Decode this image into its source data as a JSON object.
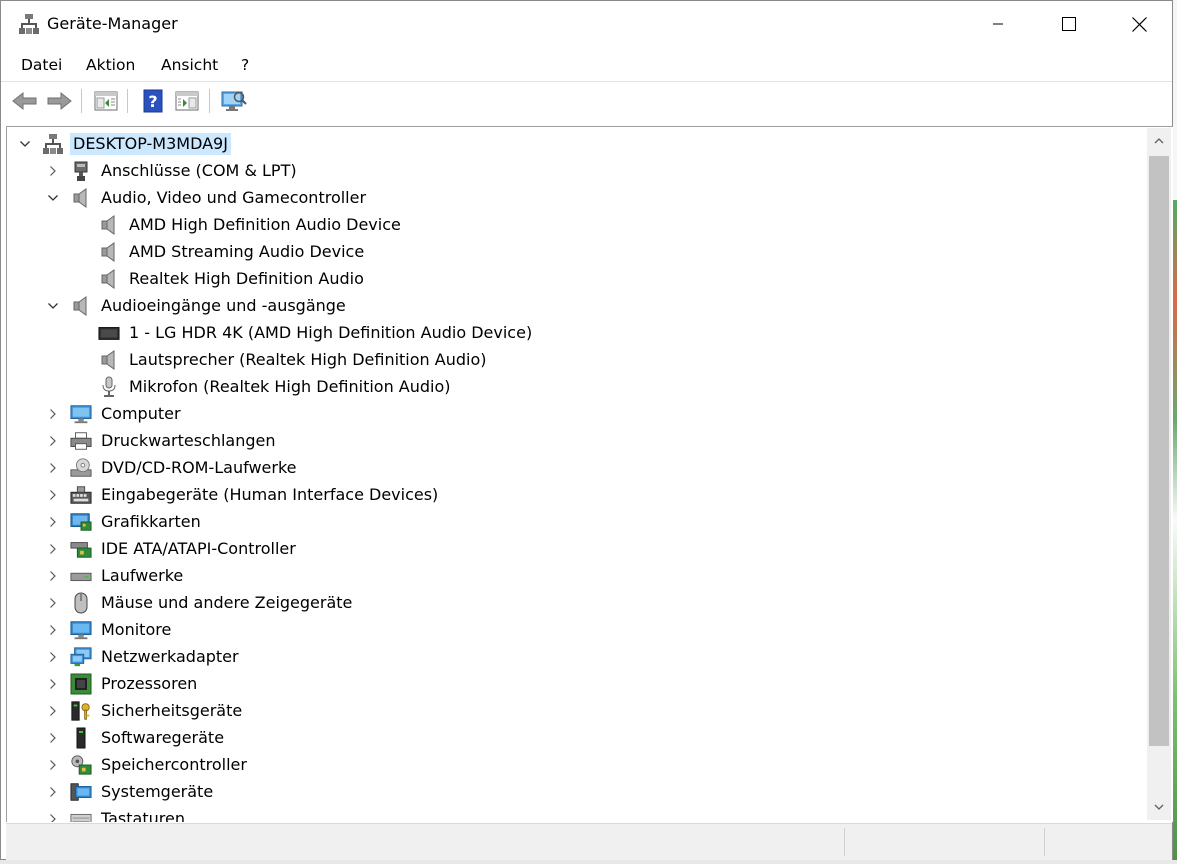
{
  "window": {
    "title": "Geräte-Manager"
  },
  "menu": {
    "items": [
      "Datei",
      "Aktion",
      "Ansicht",
      "?"
    ]
  },
  "tree": [
    {
      "label": "DESKTOP-M3MDA9J",
      "level": 0,
      "expander": "expanded",
      "icon": "computer-network-icon",
      "selected": true
    },
    {
      "label": "Anschlüsse (COM & LPT)",
      "level": 1,
      "expander": "collapsed",
      "icon": "port-icon"
    },
    {
      "label": "Audio, Video und Gamecontroller",
      "level": 1,
      "expander": "expanded",
      "icon": "speaker-icon"
    },
    {
      "label": "AMD High Definition Audio Device",
      "level": 2,
      "expander": "none",
      "icon": "speaker-icon"
    },
    {
      "label": "AMD Streaming Audio Device",
      "level": 2,
      "expander": "none",
      "icon": "speaker-icon"
    },
    {
      "label": "Realtek High Definition Audio",
      "level": 2,
      "expander": "none",
      "icon": "speaker-icon"
    },
    {
      "label": "Audioeingänge und -ausgänge",
      "level": 1,
      "expander": "expanded",
      "icon": "speaker-icon"
    },
    {
      "label": "1 - LG HDR 4K (AMD High Definition Audio Device)",
      "level": 2,
      "expander": "none",
      "icon": "display-audio-icon"
    },
    {
      "label": "Lautsprecher (Realtek High Definition Audio)",
      "level": 2,
      "expander": "none",
      "icon": "speaker-icon"
    },
    {
      "label": "Mikrofon (Realtek High Definition Audio)",
      "level": 2,
      "expander": "none",
      "icon": "microphone-icon"
    },
    {
      "label": "Computer",
      "level": 1,
      "expander": "collapsed",
      "icon": "computer-icon"
    },
    {
      "label": "Druckwarteschlangen",
      "level": 1,
      "expander": "collapsed",
      "icon": "printer-icon"
    },
    {
      "label": "DVD/CD-ROM-Laufwerke",
      "level": 1,
      "expander": "collapsed",
      "icon": "dvd-drive-icon"
    },
    {
      "label": "Eingabegeräte (Human Interface Devices)",
      "level": 1,
      "expander": "collapsed",
      "icon": "hid-icon"
    },
    {
      "label": "Grafikkarten",
      "level": 1,
      "expander": "collapsed",
      "icon": "graphics-card-icon"
    },
    {
      "label": "IDE ATA/ATAPI-Controller",
      "level": 1,
      "expander": "collapsed",
      "icon": "ide-controller-icon"
    },
    {
      "label": "Laufwerke",
      "level": 1,
      "expander": "collapsed",
      "icon": "disk-drive-icon"
    },
    {
      "label": "Mäuse und andere Zeigegeräte",
      "level": 1,
      "expander": "collapsed",
      "icon": "mouse-icon"
    },
    {
      "label": "Monitore",
      "level": 1,
      "expander": "collapsed",
      "icon": "monitor-icon"
    },
    {
      "label": "Netzwerkadapter",
      "level": 1,
      "expander": "collapsed",
      "icon": "network-adapter-icon"
    },
    {
      "label": "Prozessoren",
      "level": 1,
      "expander": "collapsed",
      "icon": "processor-icon"
    },
    {
      "label": "Sicherheitsgeräte",
      "level": 1,
      "expander": "collapsed",
      "icon": "security-device-icon"
    },
    {
      "label": "Softwaregeräte",
      "level": 1,
      "expander": "collapsed",
      "icon": "software-device-icon"
    },
    {
      "label": "Speichercontroller",
      "level": 1,
      "expander": "collapsed",
      "icon": "storage-controller-icon"
    },
    {
      "label": "Systemgeräte",
      "level": 1,
      "expander": "collapsed",
      "icon": "system-device-icon"
    },
    {
      "label": "Tastaturen",
      "level": 1,
      "expander": "collapsed",
      "icon": "keyboard-icon"
    }
  ],
  "colors": {
    "selection": "#cce8ff",
    "scrollbar_track": "#f0f0f0",
    "scrollbar_thumb": "#c2c2c2"
  }
}
